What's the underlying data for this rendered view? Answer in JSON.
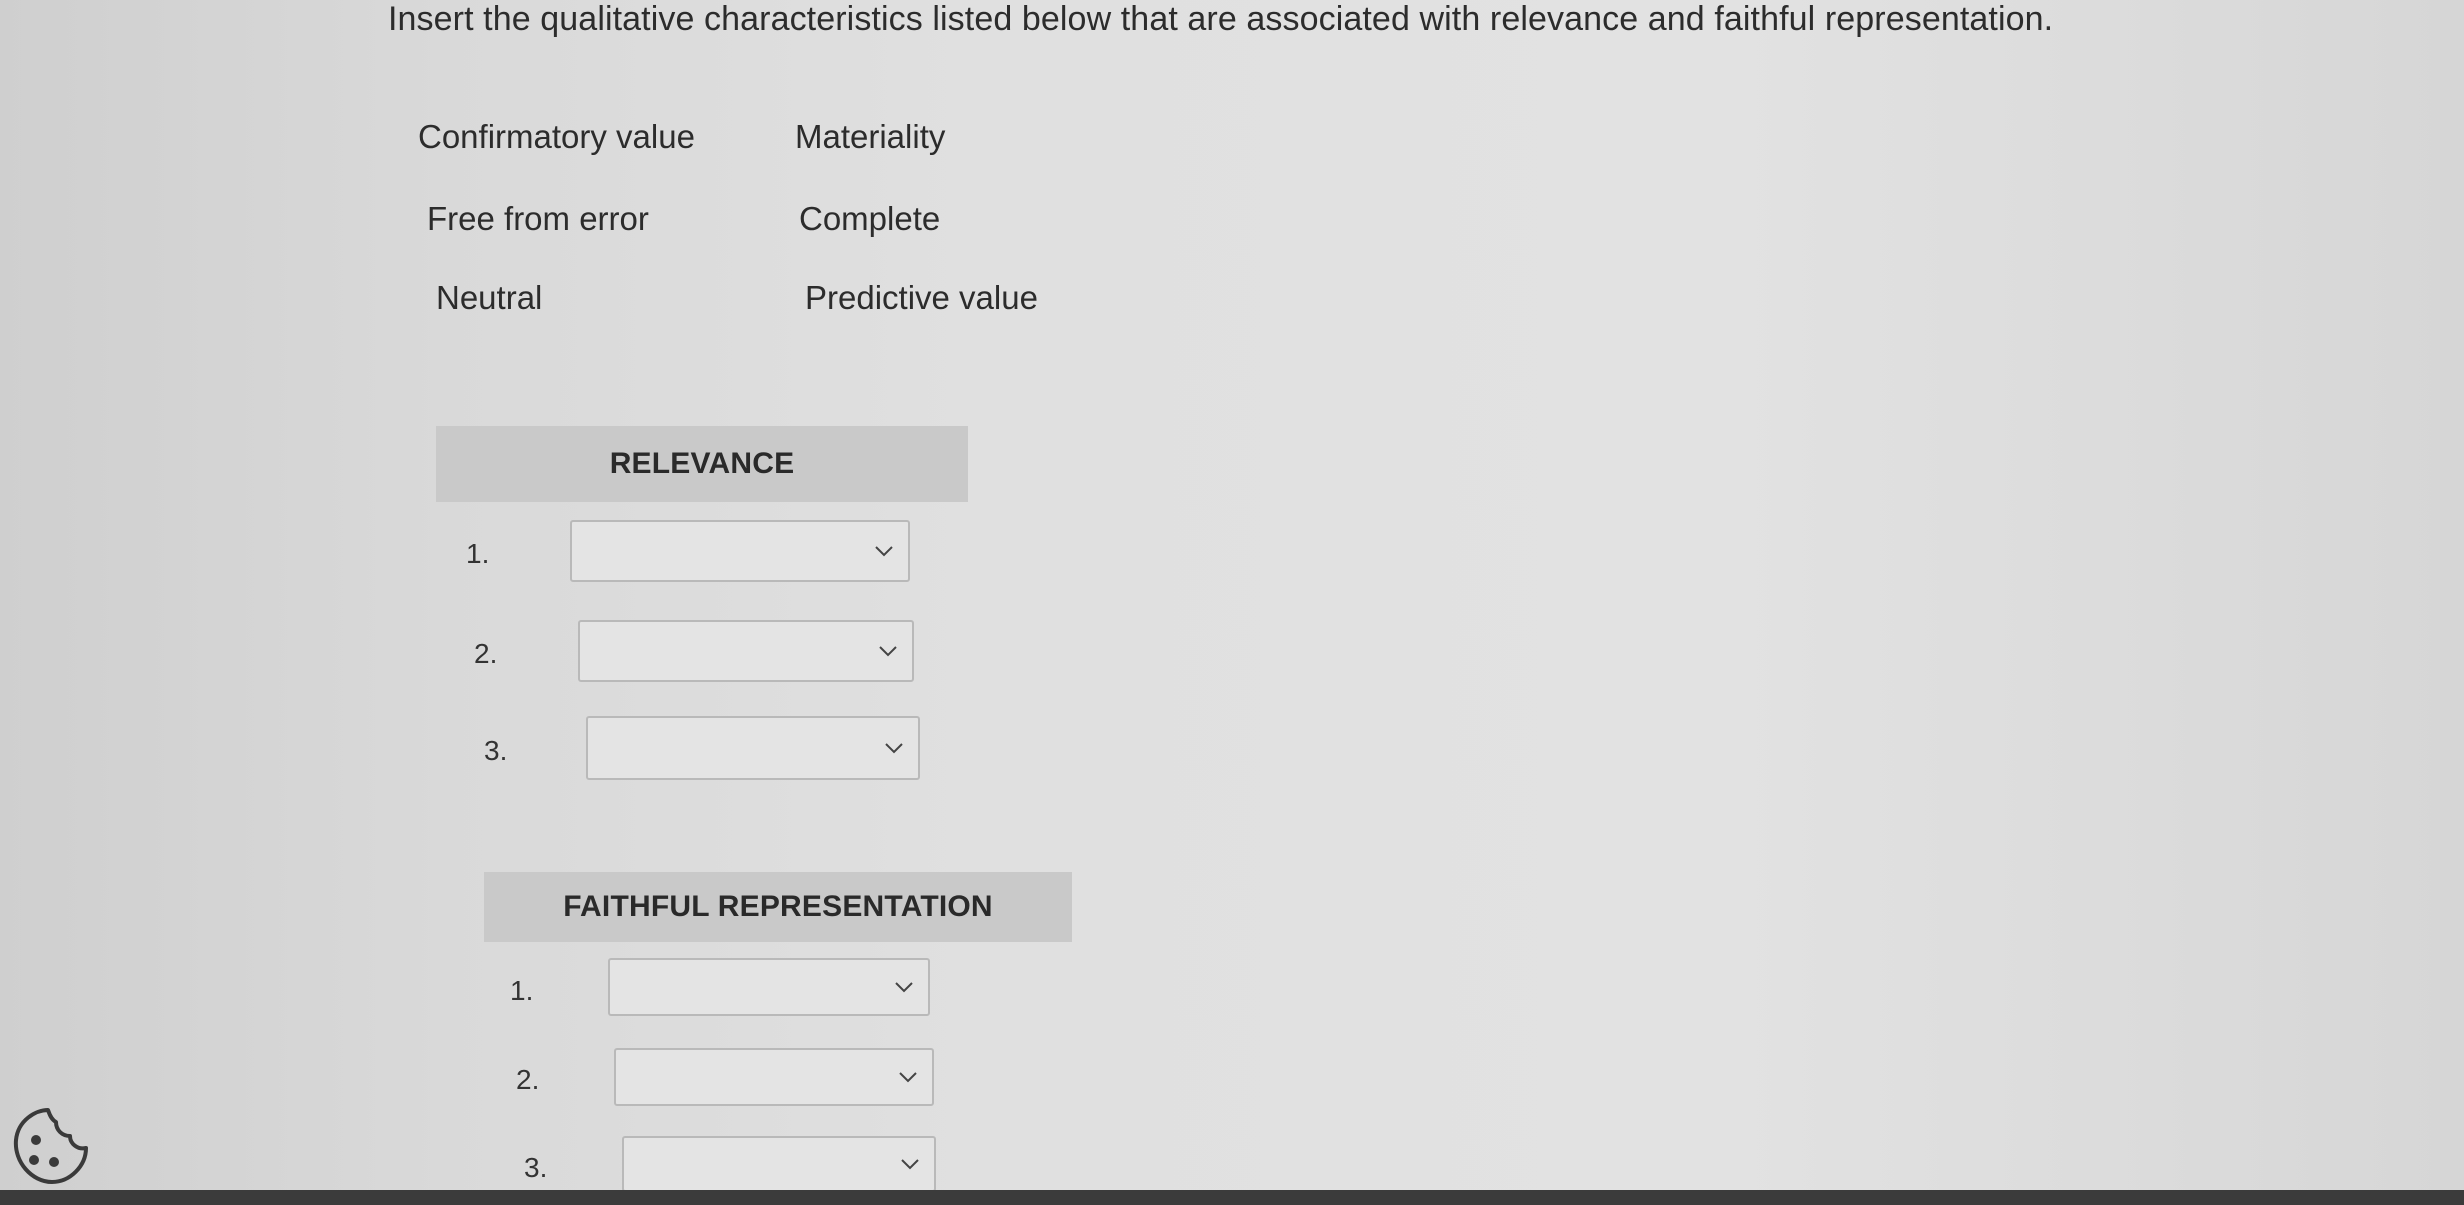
{
  "question": {
    "instruction": "Insert the qualitative characteristics listed below that are associated with relevance and faithful representation."
  },
  "terms": [
    "Confirmatory value",
    "Materiality",
    "Free from error",
    "Complete",
    "Neutral",
    "Predictive value"
  ],
  "relevance": {
    "header": "RELEVANCE",
    "rows": [
      {
        "number": "1.",
        "selected": ""
      },
      {
        "number": "2.",
        "selected": ""
      },
      {
        "number": "3.",
        "selected": ""
      }
    ]
  },
  "faithful": {
    "header": "FAITHFUL REPRESENTATION",
    "rows": [
      {
        "number": "1.",
        "selected": ""
      },
      {
        "number": "2.",
        "selected": ""
      },
      {
        "number": "3.",
        "selected": ""
      }
    ]
  },
  "icons": {
    "cookie": "cookie-icon",
    "dropdown": "chevron-down-icon"
  },
  "colors": {
    "header_bg": "#c9c9c9",
    "dropdown_border": "#b9b9b9"
  }
}
